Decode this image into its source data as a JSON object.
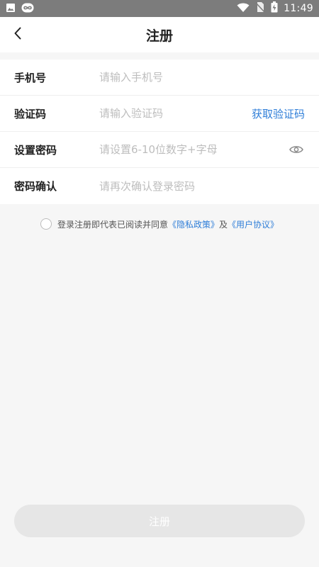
{
  "status_bar": {
    "time": "11:49",
    "icons": [
      "image-icon",
      "infinity-icon",
      "wifi-icon",
      "no-sim-icon",
      "battery-icon"
    ]
  },
  "header": {
    "title": "注册",
    "back_icon": "chevron-left-icon"
  },
  "form": {
    "phone": {
      "label": "手机号",
      "placeholder": "请输入手机号",
      "value": ""
    },
    "code": {
      "label": "验证码",
      "placeholder": "请输入验证码",
      "value": "",
      "action": "获取验证码"
    },
    "password": {
      "label": "设置密码",
      "placeholder": "请设置6-10位数字+字母",
      "value": "",
      "toggle_icon": "eye-icon"
    },
    "confirm": {
      "label": "密码确认",
      "placeholder": "请再次确认登录密码",
      "value": ""
    }
  },
  "agreement": {
    "checked": false,
    "prefix": "登录注册即代表已阅读并同意",
    "privacy_link": "《隐私政策》",
    "joiner": "及",
    "terms_link": "《用户协议》"
  },
  "submit": {
    "label": "注册",
    "enabled": false
  },
  "colors": {
    "accent": "#2f7ed8",
    "background": "#f6f6f6",
    "status_bar": "#7c7c7c",
    "placeholder": "#bdbdbd",
    "button_disabled": "#e6e6e6"
  }
}
